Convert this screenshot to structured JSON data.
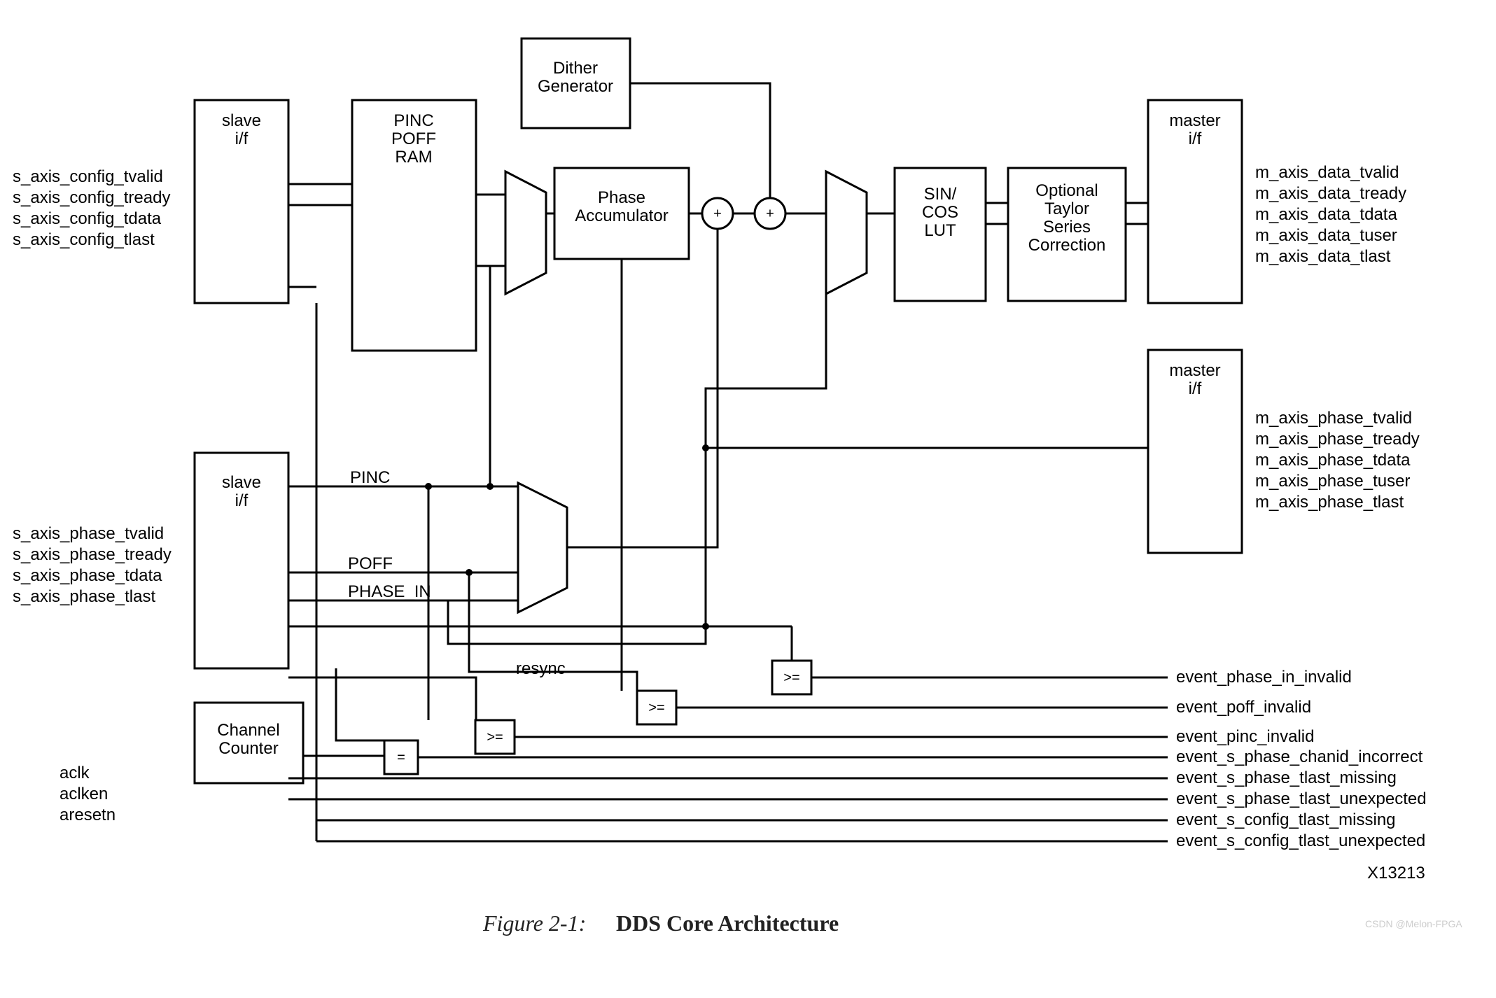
{
  "blocks": {
    "slave_config": {
      "l1": "slave",
      "l2": "i/f"
    },
    "slave_phase": {
      "l1": "slave",
      "l2": "i/f"
    },
    "master_data": {
      "l1": "master",
      "l2": "i/f"
    },
    "master_phase": {
      "l1": "master",
      "l2": "i/f"
    },
    "pinc_poff_ram": {
      "l1": "PINC",
      "l2": "POFF",
      "l3": "RAM"
    },
    "dither": {
      "l1": "Dither",
      "l2": "Generator"
    },
    "phase_acc": {
      "l1": "Phase",
      "l2": "Accumulator"
    },
    "sincos": {
      "l1": "SIN/",
      "l2": "COS",
      "l3": "LUT"
    },
    "taylor": {
      "l1": "Optional",
      "l2": "Taylor",
      "l3": "Series",
      "l4": "Correction"
    },
    "chan_cnt": {
      "l1": "Channel",
      "l2": "Counter"
    }
  },
  "signals": {
    "config_in": [
      "s_axis_config_tvalid",
      "s_axis_config_tready",
      "s_axis_config_tdata",
      "s_axis_config_tlast"
    ],
    "phase_in": [
      "s_axis_phase_tvalid",
      "s_axis_phase_tready",
      "s_axis_phase_tdata",
      "s_axis_phase_tlast"
    ],
    "clk_in": [
      "aclk",
      "aclken",
      "aresetn"
    ],
    "data_out": [
      "m_axis_data_tvalid",
      "m_axis_data_tready",
      "m_axis_data_tdata",
      "m_axis_data_tuser",
      "m_axis_data_tlast"
    ],
    "phase_out": [
      "m_axis_phase_tvalid",
      "m_axis_phase_tready",
      "m_axis_phase_tdata",
      "m_axis_phase_tuser",
      "m_axis_phase_tlast"
    ],
    "events": [
      "event_phase_in_invalid",
      "event_poff_invalid",
      "event_pinc_invalid",
      "event_s_phase_chanid_incorrect",
      "event_s_phase_tlast_missing",
      "event_s_phase_tlast_unexpected",
      "event_s_config_tlast_missing",
      "event_s_config_tlast_unexpected"
    ]
  },
  "wire_labels": {
    "pinc": "PINC",
    "poff": "POFF",
    "phase_in": "PHASE_IN",
    "resync": "resync"
  },
  "ops": {
    "ge": ">=",
    "eq": "=",
    "plus": "+"
  },
  "figure": {
    "ref": "X13213",
    "caption_lead": "Figure 2-1:",
    "caption_title": "DDS Core Architecture"
  },
  "watermark": "CSDN @Melon-FPGA"
}
